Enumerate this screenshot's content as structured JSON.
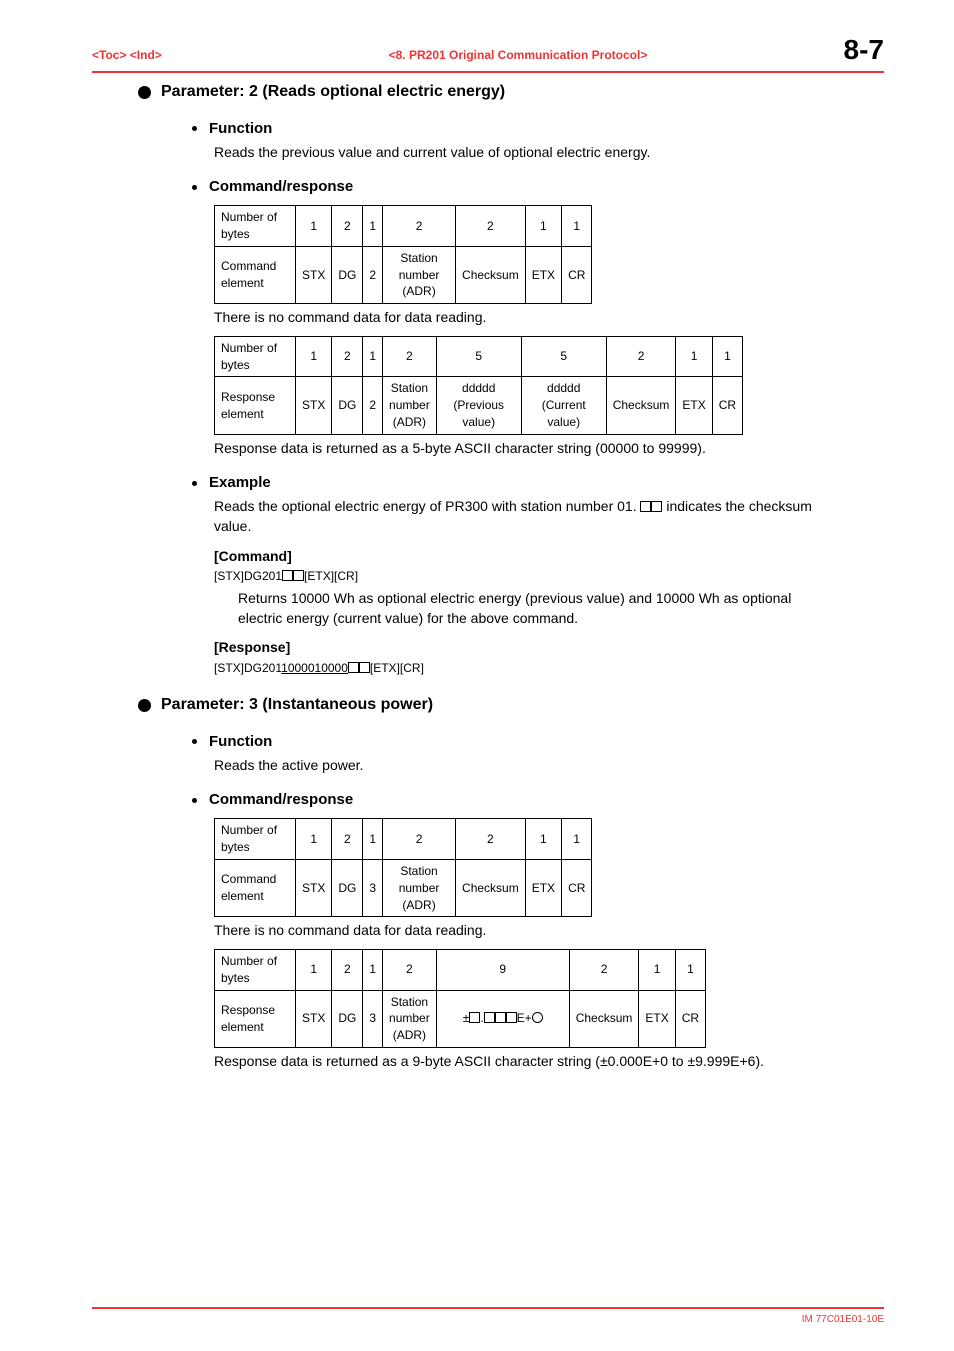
{
  "header": {
    "left": "<Toc> <Ind>",
    "center": "<8.  PR201 Original Communication Protocol>",
    "right": "8-7"
  },
  "sec1": {
    "title": "Parameter: 2 (Reads optional electric energy)",
    "function_h": "Function",
    "function_p": "Reads the previous value and current value of optional electric energy.",
    "cr_h": "Command/response",
    "cmd_table": {
      "row1_label": "Number of bytes",
      "row2_label": "Command element",
      "cols": [
        "1",
        "2",
        "1",
        "2",
        "2",
        "1",
        "1"
      ],
      "vals": [
        "STX",
        "DG",
        "2",
        "Station number (ADR)",
        "Checksum",
        "ETX",
        "CR"
      ]
    },
    "no_cmd_data": "There is no command data for data reading.",
    "resp_table": {
      "row1_label": "Number of bytes",
      "row2_label": "Response element",
      "cols": [
        "1",
        "2",
        "1",
        "2",
        "5",
        "5",
        "2",
        "1",
        "1"
      ],
      "vals": [
        "STX",
        "DG",
        "2",
        "Station number (ADR)",
        "ddddd (Previous value)",
        "ddddd (Current value)",
        "Checksum",
        "ETX",
        "CR"
      ]
    },
    "resp_note": "Response data is returned as a 5-byte ASCII character string (00000 to 99999).",
    "example_h": "Example",
    "example_p": "Reads the optional electric energy of PR300 with station number 01. □□ indicates the checksum value.",
    "cmd_label": "[Command]",
    "cmd_code": "[STX]DG201□□[ETX][CR]",
    "cmd_ret": "Returns 10000 Wh as optional electric energy (previous value) and 10000 Wh as optional electric energy (current value) for the above command.",
    "resp_label": "[Response]",
    "resp_code_pre": "[STX]DG201",
    "resp_code_u1": "10000",
    "resp_code_u2": "10000",
    "resp_code_post": "□□[ETX][CR]"
  },
  "sec2": {
    "title": "Parameter: 3 (Instantaneous power)",
    "function_h": "Function",
    "function_p": "Reads the active power.",
    "cr_h": " Command/response",
    "cmd_table": {
      "row1_label": "Number of bytes",
      "row2_label": "Command element",
      "cols": [
        "1",
        "2",
        "1",
        "2",
        "2",
        "1",
        "1"
      ],
      "vals": [
        "STX",
        "DG",
        "3",
        "Station number (ADR)",
        "Checksum",
        "ETX",
        "CR"
      ]
    },
    "no_cmd_data": "There is no command data for data reading.",
    "resp_table": {
      "row1_label": "Number of bytes",
      "row2_label": "Response element",
      "cols": [
        "1",
        "2",
        "1",
        "2",
        "9",
        "2",
        "1",
        "1"
      ],
      "vals": [
        "STX",
        "DG",
        "3",
        "Station number (ADR)",
        "±□.□□□E+○",
        "Checksum",
        "ETX",
        "CR"
      ]
    },
    "resp_note": "Response data is returned as a 9-byte ASCII character string (±0.000E+0 to ±9.999E+6)."
  },
  "footer": "IM 77C01E01-10E"
}
